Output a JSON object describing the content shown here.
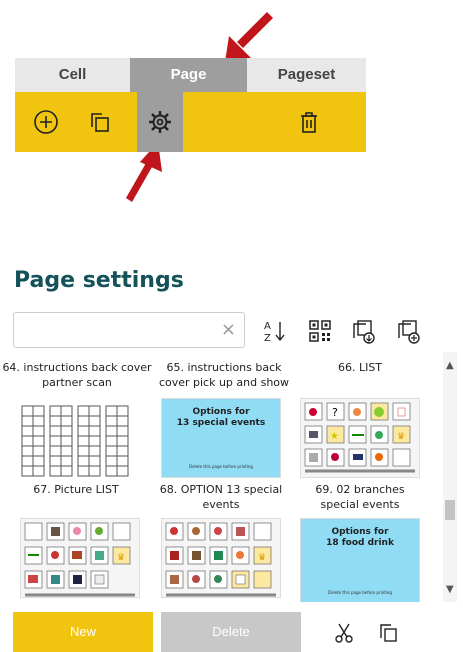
{
  "tabs": {
    "cell": "Cell",
    "page": "Page",
    "pageset": "Pageset"
  },
  "toolbar_icons": [
    "add-icon",
    "copy-icon",
    "gear-icon",
    "trash-icon"
  ],
  "section_title": "Page settings",
  "search": {
    "value": "",
    "placeholder": ""
  },
  "header_icons": [
    "sort-az-icon",
    "qr-icon",
    "export-icon",
    "add-page-icon"
  ],
  "pages": {
    "p64": "64. instructions back cover partner scan",
    "p65": "65. instructions back cover pick up and show",
    "p66": "66. LIST",
    "p67": "67. Picture LIST",
    "p68": "68. OPTION 13 special events",
    "p69": "69. 02 branches special events"
  },
  "thumbs": {
    "options13_title": "Options for\n13 special events",
    "options13_note": "Delete this page before printing",
    "options18_title": "Options for\n18 food drink",
    "options18_note": "Delete this page before printing"
  },
  "buttons": {
    "new": "New",
    "delete": "Delete"
  },
  "colors": {
    "accent": "#f1c40f",
    "tab_active": "#9e9e9e",
    "title": "#14525a",
    "arrow": "#c0151b",
    "thumb_blue": "#8fdcf4"
  }
}
